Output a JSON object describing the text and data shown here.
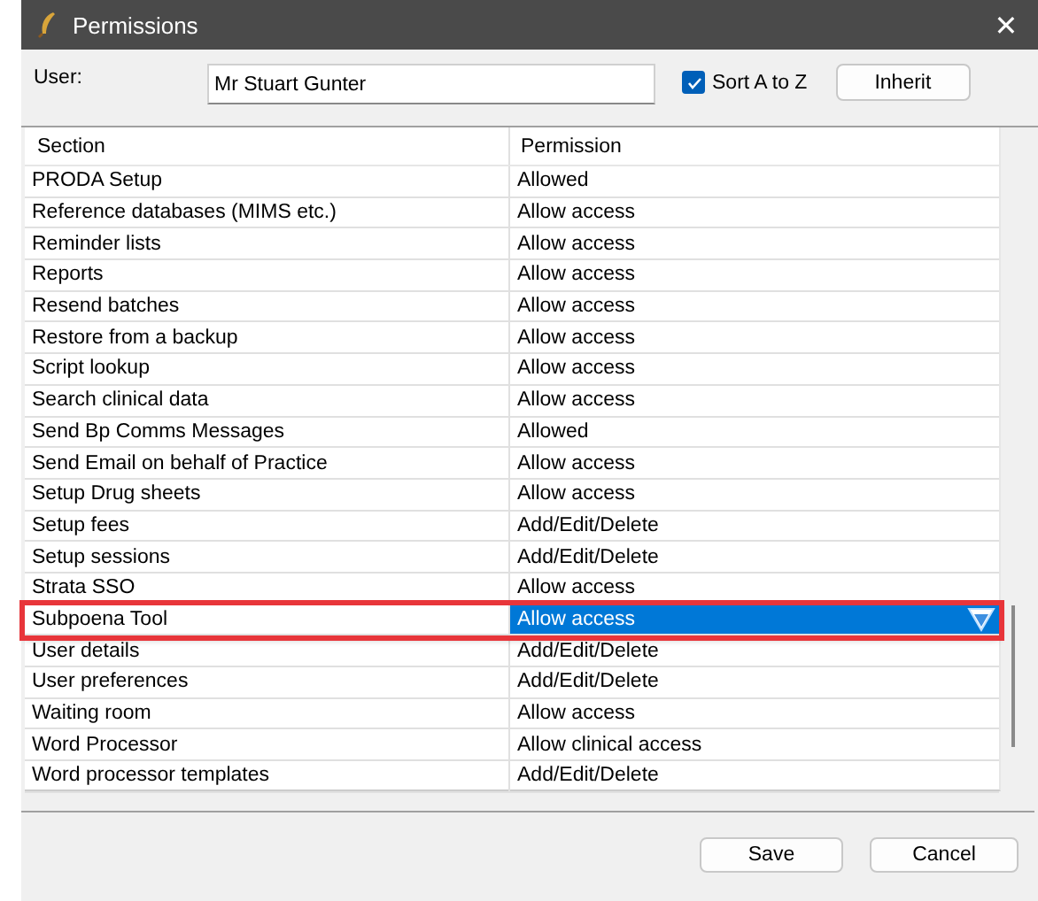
{
  "window": {
    "title": "Permissions",
    "close": "✕"
  },
  "user": {
    "label": "User:",
    "value": "Mr Stuart Gunter"
  },
  "sort": {
    "label": "Sort A to Z",
    "checked": true
  },
  "inherit_button": "Inherit",
  "table": {
    "columns": [
      "Section",
      "Permission"
    ],
    "rows": [
      {
        "section": "PRODA Setup",
        "permission": "Allowed",
        "selected": false
      },
      {
        "section": "Reference databases (MIMS etc.)",
        "permission": "Allow access",
        "selected": false
      },
      {
        "section": "Reminder lists",
        "permission": "Allow access",
        "selected": false
      },
      {
        "section": "Reports",
        "permission": "Allow access",
        "selected": false
      },
      {
        "section": "Resend batches",
        "permission": "Allow access",
        "selected": false
      },
      {
        "section": "Restore from a backup",
        "permission": "Allow access",
        "selected": false
      },
      {
        "section": "Script lookup",
        "permission": "Allow access",
        "selected": false
      },
      {
        "section": "Search clinical data",
        "permission": "Allow access",
        "selected": false
      },
      {
        "section": "Send Bp Comms Messages",
        "permission": "Allowed",
        "selected": false
      },
      {
        "section": "Send Email on behalf of Practice",
        "permission": "Allow access",
        "selected": false
      },
      {
        "section": "Setup Drug sheets",
        "permission": "Allow access",
        "selected": false
      },
      {
        "section": "Setup fees",
        "permission": "Add/Edit/Delete",
        "selected": false
      },
      {
        "section": "Setup sessions",
        "permission": "Add/Edit/Delete",
        "selected": false
      },
      {
        "section": "Strata SSO",
        "permission": "Allow access",
        "selected": false
      },
      {
        "section": "Subpoena Tool",
        "permission": "Allow access",
        "selected": true
      },
      {
        "section": "User details",
        "permission": "Add/Edit/Delete",
        "selected": false
      },
      {
        "section": "User preferences",
        "permission": "Add/Edit/Delete",
        "selected": false
      },
      {
        "section": "Waiting room",
        "permission": "Allow access",
        "selected": false
      },
      {
        "section": "Word Processor",
        "permission": "Allow clinical access",
        "selected": false
      },
      {
        "section": "Word processor templates",
        "permission": "Add/Edit/Delete",
        "selected": false
      }
    ]
  },
  "buttons": [
    "Save",
    "Cancel"
  ]
}
